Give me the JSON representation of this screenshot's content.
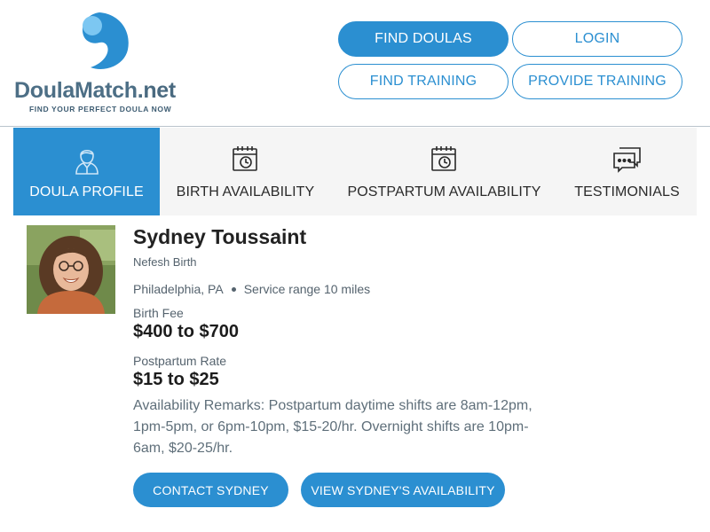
{
  "brand": {
    "name_main": "DoulaMatch",
    "name_tld": ".net",
    "tagline": "FIND YOUR PERFECT DOULA NOW",
    "logo_icon": "yin-yang-drop-icon",
    "colors": {
      "primary": "#2b8fd1",
      "logo_text": "#4d6f86",
      "tab_bg": "#f5f5f5"
    }
  },
  "nav": {
    "find_doulas": "FIND DOULAS",
    "login": "LOGIN",
    "find_training": "FIND TRAINING",
    "provide_training": "PROVIDE TRAINING"
  },
  "tabs": [
    {
      "label": "DOULA PROFILE",
      "icon": "person-icon",
      "active": true
    },
    {
      "label": "BIRTH AVAILABILITY",
      "icon": "calendar-clock-icon",
      "active": false
    },
    {
      "label": "POSTPARTUM AVAILABILITY",
      "icon": "calendar-clock-icon",
      "active": false
    },
    {
      "label": "TESTIMONIALS",
      "icon": "chat-bubbles-icon",
      "active": false
    }
  ],
  "profile": {
    "name": "Sydney Toussaint",
    "organization": "Nefesh Birth",
    "location": "Philadelphia, PA",
    "service_range": "Service range 10 miles",
    "birth_fee_label": "Birth Fee",
    "birth_fee": "$400 to $700",
    "postpartum_label": "Postpartum Rate",
    "postpartum_rate": "$15 to $25",
    "remarks": "Availability Remarks: Postpartum daytime shifts are 8am-12pm, 1pm-5pm, or 6pm-10pm, $15-20/hr. Overnight shifts are 10pm-6am, $20-25/hr."
  },
  "actions": {
    "contact": "CONTACT SYDNEY",
    "view_availability": "VIEW SYDNEY'S AVAILABILITY"
  }
}
